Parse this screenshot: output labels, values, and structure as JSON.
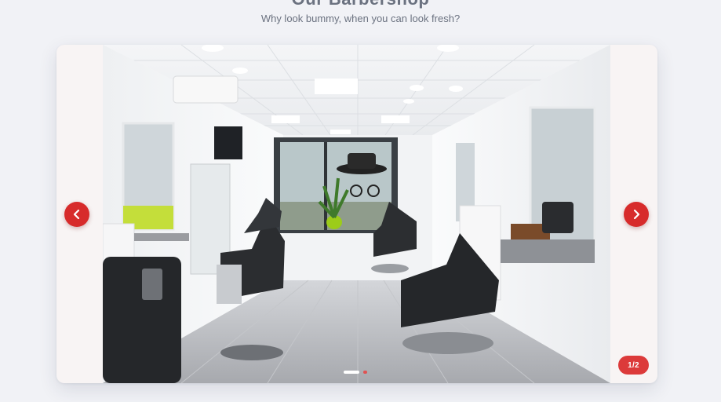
{
  "section": {
    "title": "Our Barbershop",
    "subtitle": "Why look bummy, when you can look fresh?"
  },
  "carousel": {
    "counter": "1/2",
    "prev_icon": "chevron-left-icon",
    "next_icon": "chevron-right-icon",
    "slides": [
      {
        "alt": "Barbershop interior"
      }
    ],
    "active_index": 0,
    "total_slides": 2
  },
  "colors": {
    "accent": "#d72b2b",
    "background": "#f1f2f6",
    "text_muted": "#6b7280"
  }
}
